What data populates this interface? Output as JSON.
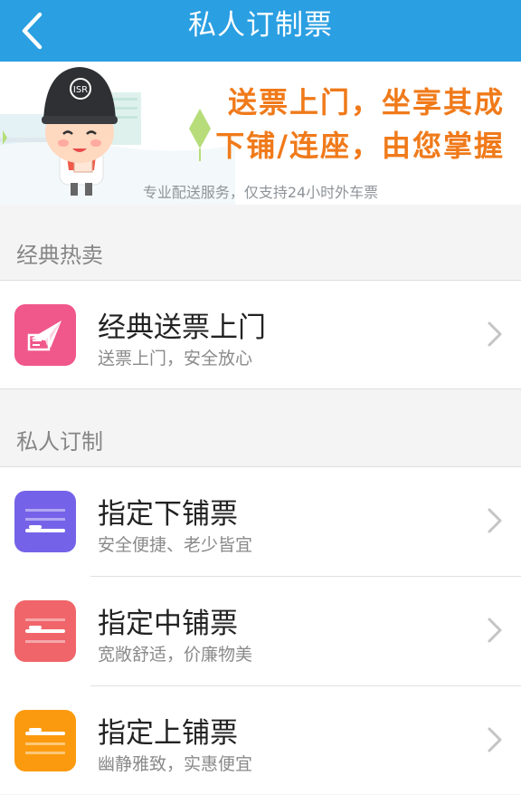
{
  "header": {
    "title": "私人订制票",
    "back_icon": "chevron-left-icon",
    "background": "#2a9fe2"
  },
  "banner": {
    "slogan_line1": "送票上门，坐享其成",
    "slogan_line2": "下铺/连座，由您掌握",
    "note": "专业配送服务，仅支持24小时外车票",
    "mascot_badge_text": "ISR",
    "accent_color": "#f07a1a"
  },
  "sections": [
    {
      "title": "经典热卖",
      "items": [
        {
          "title": "经典送票上门",
          "subtitle": "送票上门，安全放心",
          "icon": "paper-plane-ticket-icon",
          "color": "#f0578a"
        }
      ]
    },
    {
      "title": "私人订制",
      "items": [
        {
          "title": "指定下铺票",
          "subtitle": "安全便捷、老少皆宜",
          "icon": "lower-berth-icon",
          "color": "#7463e8"
        },
        {
          "title": "指定中铺票",
          "subtitle": "宽敞舒适，价廉物美",
          "icon": "middle-berth-icon",
          "color": "#f0656a"
        },
        {
          "title": "指定上铺票",
          "subtitle": "幽静雅致，实惠便宜",
          "icon": "upper-berth-icon",
          "color": "#fb9a0e"
        }
      ]
    }
  ]
}
